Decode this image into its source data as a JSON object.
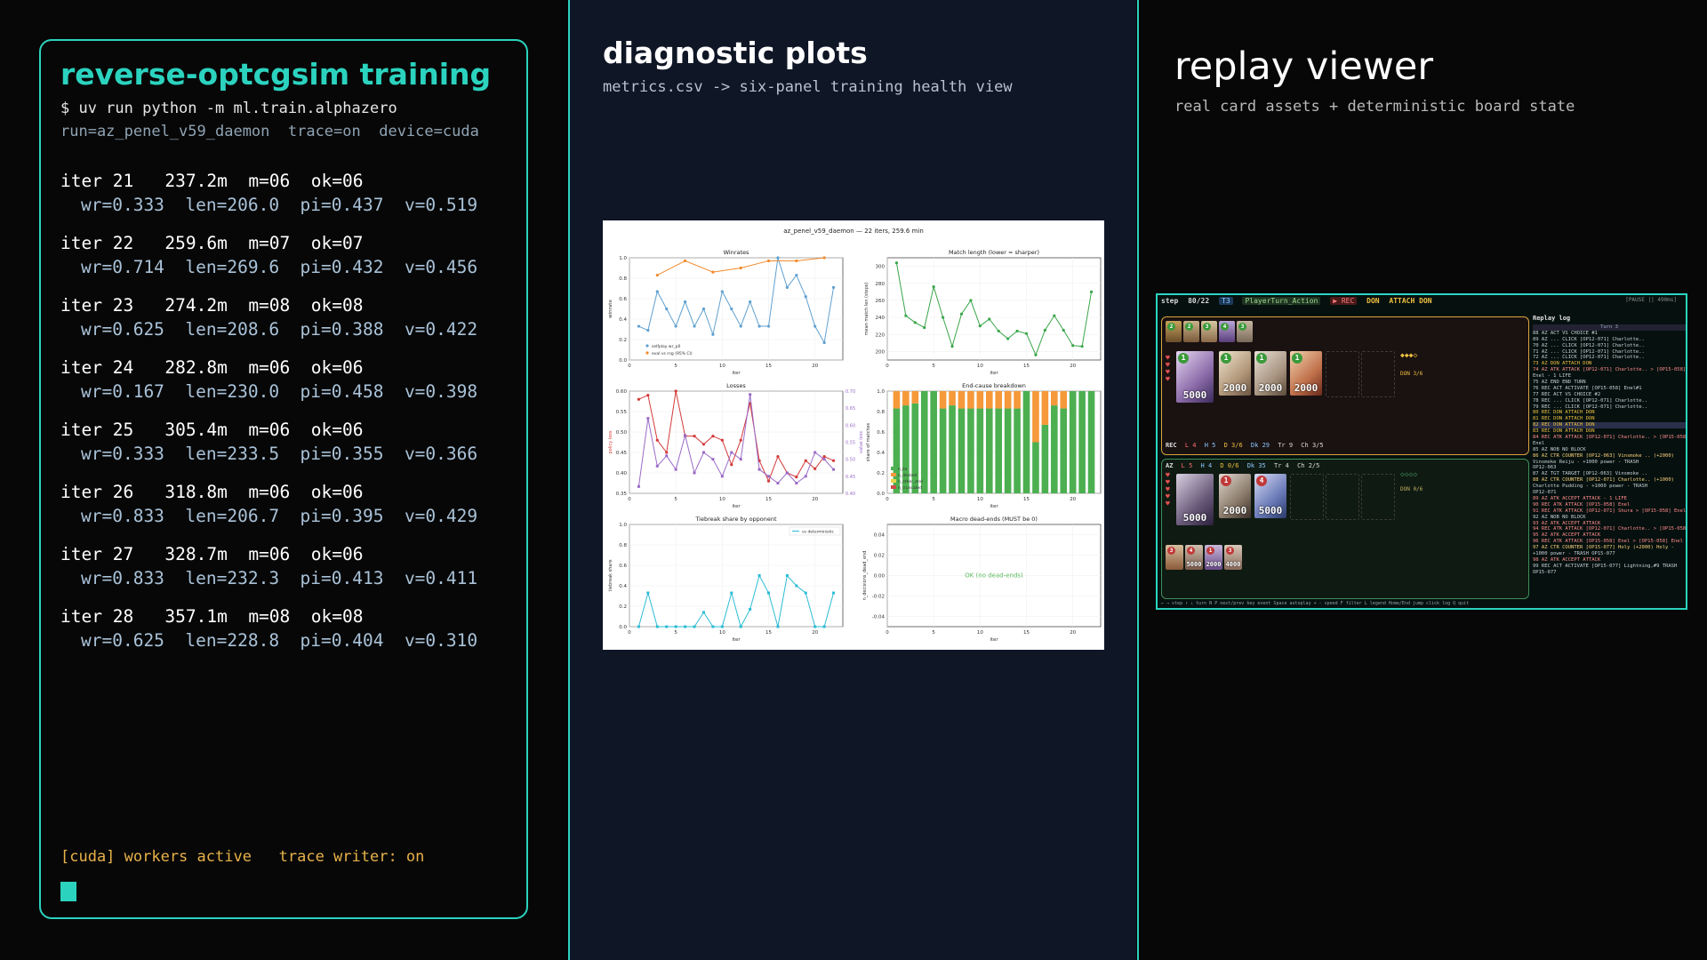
{
  "terminal": {
    "title": "reverse-optcgsim training",
    "command": "$ uv run python -m ml.train.alphazero",
    "run_info": "run=az_penel_v59_daemon  trace=on  device=cuda",
    "iterations": [
      {
        "l1": "iter 21   237.2m  m=06  ok=06",
        "l2": "wr=0.333  len=206.0  pi=0.437  v=0.519"
      },
      {
        "l1": "iter 22   259.6m  m=07  ok=07",
        "l2": "wr=0.714  len=269.6  pi=0.432  v=0.456"
      },
      {
        "l1": "iter 23   274.2m  m=08  ok=08",
        "l2": "wr=0.625  len=208.6  pi=0.388  v=0.422"
      },
      {
        "l1": "iter 24   282.8m  m=06  ok=06",
        "l2": "wr=0.167  len=230.0  pi=0.458  v=0.398"
      },
      {
        "l1": "iter 25   305.4m  m=06  ok=06",
        "l2": "wr=0.333  len=233.5  pi=0.355  v=0.366"
      },
      {
        "l1": "iter 26   318.8m  m=06  ok=06",
        "l2": "wr=0.833  len=206.7  pi=0.395  v=0.429"
      },
      {
        "l1": "iter 27   328.7m  m=06  ok=06",
        "l2": "wr=0.833  len=232.3  pi=0.413  v=0.411"
      },
      {
        "l1": "iter 28   357.1m  m=08  ok=08",
        "l2": "wr=0.625  len=228.8  pi=0.404  v=0.310"
      }
    ],
    "footer": "[cuda] workers active   trace writer: on"
  },
  "diagnostics": {
    "title": "diagnostic plots",
    "subtitle": "metrics.csv -> six-panel training health view",
    "figure_title": "az_penel_v59_daemon — 22 iters, 259.6 min",
    "panel_titles": [
      "Winrates",
      "Match length (lower = sharper)",
      "Losses",
      "End-cause breakdown",
      "Tiebreak share by opponent",
      "Macro dead-ends (MUST be 0)"
    ],
    "xlabel": "iter",
    "ok_text": "OK (no dead-ends)",
    "legend_winrates": [
      "selfplay wr_p0",
      "eval vs rng (95% CI)"
    ],
    "legend_endcause": [
      "n_ko",
      "n_decked",
      "n_other_end",
      "n_truncated"
    ],
    "legend_tiebreak": [
      "vs deterministic"
    ],
    "ylabel_winrates": "winrate",
    "ylabel_len": "mean match len (steps)",
    "ylabel_loss_left": "policy loss",
    "ylabel_loss_right": "value loss",
    "ylabel_end": "share of matches",
    "ylabel_tie": "tiebreak share",
    "ylabel_dead": "n_decisions_dead_end"
  },
  "chart_data": [
    {
      "type": "line",
      "title": "Winrates",
      "xlabel": "iter",
      "ylabel": "winrate",
      "x": [
        1,
        2,
        3,
        4,
        5,
        6,
        7,
        8,
        9,
        10,
        11,
        12,
        13,
        14,
        15,
        16,
        17,
        18,
        19,
        20,
        21,
        22
      ],
      "series": [
        {
          "name": "selfplay wr_p0",
          "values": [
            0.33,
            0.29,
            0.67,
            0.5,
            0.33,
            0.57,
            0.33,
            0.5,
            0.25,
            0.67,
            0.5,
            0.33,
            0.57,
            0.33,
            0.33,
            1.0,
            0.71,
            0.83,
            0.62,
            0.33,
            0.17,
            0.71
          ]
        },
        {
          "name": "eval vs rng (95% CI)",
          "x": [
            3,
            6,
            9,
            12,
            15,
            18,
            21
          ],
          "values": [
            0.83,
            0.97,
            0.86,
            0.9,
            0.97,
            0.97,
            1.0
          ]
        }
      ],
      "ylim": [
        0,
        1.0
      ]
    },
    {
      "type": "line",
      "title": "Match length (lower = sharper)",
      "xlabel": "iter",
      "ylabel": "mean match len (steps)",
      "x": [
        1,
        2,
        3,
        4,
        5,
        6,
        7,
        8,
        9,
        10,
        11,
        12,
        13,
        14,
        15,
        16,
        17,
        18,
        19,
        20,
        21,
        22
      ],
      "series": [
        {
          "name": "",
          "values": [
            304,
            242,
            234,
            228,
            276,
            240,
            206,
            244,
            260,
            230,
            238,
            224,
            215,
            224,
            221,
            196,
            225,
            242,
            225,
            207,
            206,
            270
          ]
        }
      ],
      "ylim": [
        190,
        310
      ]
    },
    {
      "type": "line",
      "title": "Losses",
      "xlabel": "iter",
      "ylabel": "policy loss",
      "x": [
        1,
        2,
        3,
        4,
        5,
        6,
        7,
        8,
        9,
        10,
        11,
        12,
        13,
        14,
        15,
        16,
        17,
        18,
        19,
        20,
        21,
        22
      ],
      "series": [
        {
          "name": "policy loss",
          "values": [
            0.58,
            0.59,
            0.48,
            0.45,
            0.6,
            0.49,
            0.49,
            0.47,
            0.49,
            0.48,
            0.42,
            0.48,
            0.57,
            0.43,
            0.38,
            0.44,
            0.4,
            0.39,
            0.43,
            0.41,
            0.44,
            0.43
          ]
        },
        {
          "name": "value loss",
          "values": [
            0.42,
            0.62,
            0.48,
            0.51,
            0.47,
            0.57,
            0.46,
            0.52,
            0.5,
            0.45,
            0.52,
            0.5,
            0.69,
            0.47,
            0.45,
            0.43,
            0.46,
            0.43,
            0.45,
            0.52,
            0.5,
            0.47
          ]
        }
      ],
      "ylim": [
        0.35,
        0.6
      ]
    },
    {
      "type": "bar",
      "title": "End-cause breakdown",
      "xlabel": "iter",
      "ylabel": "share of matches",
      "categories": [
        "1",
        "2",
        "3",
        "4",
        "5",
        "6",
        "7",
        "8",
        "9",
        "10",
        "11",
        "12",
        "13",
        "14",
        "15",
        "16",
        "17",
        "18",
        "19",
        "20",
        "21",
        "22"
      ],
      "series": [
        {
          "name": "n_ko",
          "values": [
            0.83,
            0.86,
            0.88,
            1.0,
            1.0,
            0.83,
            0.86,
            0.83,
            0.83,
            0.83,
            0.83,
            0.83,
            0.83,
            0.83,
            1.0,
            0.5,
            0.67,
            0.86,
            0.83,
            1.0,
            1.0,
            1.0
          ]
        },
        {
          "name": "n_decked",
          "values": [
            0.17,
            0.14,
            0.12,
            0.0,
            0.0,
            0.17,
            0.14,
            0.17,
            0.17,
            0.17,
            0.17,
            0.17,
            0.17,
            0.17,
            0.0,
            0.5,
            0.33,
            0.14,
            0.17,
            0.0,
            0.0,
            0.0
          ]
        },
        {
          "name": "n_other_end",
          "values": [
            0,
            0,
            0,
            0,
            0,
            0,
            0,
            0,
            0,
            0,
            0,
            0,
            0,
            0,
            0,
            0,
            0,
            0,
            0,
            0,
            0,
            0
          ]
        },
        {
          "name": "n_truncated",
          "values": [
            0,
            0,
            0,
            0,
            0,
            0,
            0,
            0,
            0,
            0,
            0,
            0,
            0,
            0,
            0,
            0,
            0,
            0,
            0,
            0,
            0,
            0
          ]
        }
      ],
      "ylim": [
        0,
        1.0
      ]
    },
    {
      "type": "line",
      "title": "Tiebreak share by opponent",
      "xlabel": "iter",
      "ylabel": "tiebreak share",
      "x": [
        1,
        2,
        3,
        4,
        5,
        6,
        7,
        8,
        9,
        10,
        11,
        12,
        13,
        14,
        15,
        16,
        17,
        18,
        19,
        20,
        21,
        22
      ],
      "series": [
        {
          "name": "vs deterministic",
          "values": [
            0,
            0.33,
            0,
            0,
            0,
            0,
            0,
            0.14,
            0,
            0,
            0.33,
            0,
            0.17,
            0.5,
            0.33,
            0,
            0.5,
            0.4,
            0.33,
            0,
            0,
            0.33
          ]
        }
      ],
      "ylim": [
        0,
        1.0
      ]
    },
    {
      "type": "line",
      "title": "Macro dead-ends (MUST be 0)",
      "xlabel": "iter",
      "ylabel": "n_decisions_dead_end",
      "series": [],
      "ylim": [
        -0.05,
        0.05
      ]
    }
  ],
  "replay": {
    "title": "replay viewer",
    "subtitle": "real card assets + deterministic board state",
    "topbar": {
      "step": "step",
      "step_val": "80/22",
      "turn": "T3",
      "phase": "PlayerTurn_Action",
      "rec": "▶ REC",
      "don": "DON",
      "attach": "ATTACH DON",
      "pause": "[PAUSE || 490ms]"
    },
    "top_stats": [
      "REC",
      "L 4",
      "H 5",
      "D 3/6",
      "Dk 29",
      "Tr 9",
      "Ch 3/5"
    ],
    "bot_stats": [
      "AZ",
      "L 5",
      "H 4",
      "D 0/6",
      "Dk 35",
      "Tr 4",
      "Ch 2/5"
    ],
    "don_top": "DON 3/6",
    "don_bot": "DON 0/6",
    "top_leader_power": "5000",
    "top_chars": [
      "2000",
      "2000",
      "2000"
    ],
    "bot_leader_power": "5000",
    "bot_chars": [
      "2000",
      "5000"
    ],
    "bot_hand": [
      "5000",
      "2000",
      "4000"
    ],
    "log_header": "Replay log",
    "log_subheader": "Turn 3",
    "log_lines": [
      "88 AZ ACT VS CHOICE #1",
      "89 AZ ... CLICK [OP12-071] Charlotte..",
      "70 AZ ... CLICK [OP12-071] Charlotte..",
      "71 AZ ... CLICK [OP12-071] Charlotte..",
      "72 AZ ... CLICK [OP12-071] Charlotte..",
      "73 AZ DON ATTACH DON",
      "74 AZ ATK ATTACK [OP12-071] Charlotte.. > [OP15-058]",
      "   Enel - 1 LIFE",
      "75 AZ END END TURN",
      "76 REC ACT ACTIVATE [OP15-058] Enel#1",
      "77 REC ACT VS CHOICE #2",
      "78 REC ... CLICK [OP12-071] Charlotte..",
      "79 REC ... CLICK [OP12-071] Charlotte..",
      "80 REC DON ATTACH DON",
      "81 REC DON ATTACH DON",
      "82 REC DON ATTACH DON",
      "83 REC DON ATTACH DON",
      "84 REC ATK ATTACK [OP12-071] Charlotte.. > [OP15-058]",
      "   Enel",
      "85 AZ NOB NO BLOCK",
      "86 AZ CTR COUNTER [OP12-063] Vinsmoke .. (+2000)",
      "   Vinsmoke Reiju - +1000 power - TRASH",
      "   OP12-063",
      "87 AZ TGT TARGET [OP12-063] Vinsmoke ..",
      "88 AZ CTR COUNTER [OP12-071] Charlotte.. (+1000)",
      "   Charlotte Pudding - +1000 power - TRASH",
      "   OP12-071",
      "89 AZ ATK ACCEPT ATTACK - 1 LIFE",
      "90 REC ATK ATTACK [OP15-058] Enel",
      "91 REC ATK ATTACK [OP12-071] Shura > [OP15-058] Enel",
      "92 AZ NOB NO BLOCK",
      "93 AZ ATK ACCEPT ATTACK",
      "94 REC ATK ATTACK [OP12-071] Charlotte.. > [OP15-058]",
      "95 AZ ATK ACCEPT ATTACK",
      "96 REC ATK ATTACK [OP15-058] Enel > [OP15-058] Enel",
      "97 AZ CTR COUNTER [OP15-077] Holy (+2000) Holy -",
      "   +1000 power - TRASH OP15-077",
      "98 AZ ATK ACCEPT ATTACK",
      "99 REC ACT ACTIVATE [OP15-077] Lightning,#9 TRASH",
      "   OP15-077"
    ],
    "bottom_help": "← → step   ↑ ↓ turn   N P next/prev key event   Space autoplay   + - speed   F filter   L legend   Home/End jump   click log   Q quit"
  }
}
